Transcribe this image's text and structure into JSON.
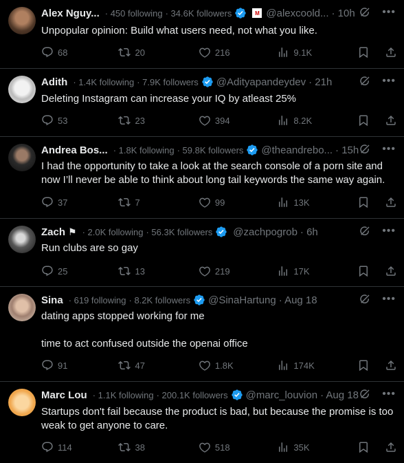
{
  "tweets": [
    {
      "name": "Alex Nguy...",
      "following": "· 450 following",
      "followers": "· 34.6K followers",
      "handle": "@alexcoold...",
      "time": "· 10h",
      "text": "Unpopular opinion: Build what users need, not what you like.",
      "reply": "68",
      "retweet": "20",
      "like": "216",
      "views": "9.1K"
    },
    {
      "name": "Adith",
      "following": "· 1.4K following",
      "followers": "· 7.9K followers",
      "handle": "@Adityapandeydev",
      "time": "· 21h",
      "text": "Deleting Instagram can increase your IQ by atleast 25%",
      "reply": "53",
      "retweet": "23",
      "like": "394",
      "views": "8.2K"
    },
    {
      "name": "Andrea Bos...",
      "following": "· 1.8K following",
      "followers": "· 59.8K followers",
      "handle": "@theandrebo...",
      "time": "· 15h",
      "text": "I had the opportunity to take a look at the search console of a porn site and now I’ll never be able to think about long tail keywords the same way again.",
      "reply": "37",
      "retweet": "7",
      "like": "99",
      "views": "13K"
    },
    {
      "name": "Zach",
      "following": "· 2.0K following",
      "followers": "· 56.3K followers",
      "handle": "@zachpogrob",
      "time": "· 6h",
      "text": "Run clubs are so gay",
      "reply": "25",
      "retweet": "13",
      "like": "219",
      "views": "17K"
    },
    {
      "name": "Sina",
      "following": "· 619 following",
      "followers": "· 8.2K followers",
      "handle": "@SinaHartung",
      "time": "· Aug 18",
      "text": "dating apps stopped working for me\n\ntime to act confused outside the openai office",
      "reply": "91",
      "retweet": "47",
      "like": "1.8K",
      "views": "174K"
    },
    {
      "name": "Marc Lou",
      "following": "· 1.1K following",
      "followers": "· 200.1K followers",
      "handle": "@marc_louvion",
      "time": "· Aug 18",
      "text": "Startups don't fail because the product is bad, but because the promise is too weak to get anyone to care.",
      "reply": "114",
      "retweet": "38",
      "like": "518",
      "views": "35K"
    }
  ],
  "colors": {
    "verified": "#1d9bf0",
    "muted": "#71767b",
    "text": "#e7e9ea",
    "divider": "#2f3336"
  },
  "icons": [
    "reply-icon",
    "retweet-icon",
    "like-icon",
    "views-icon",
    "bookmark-icon",
    "share-icon",
    "grok-icon",
    "more-icon",
    "verified-icon",
    "flag-icon"
  ]
}
